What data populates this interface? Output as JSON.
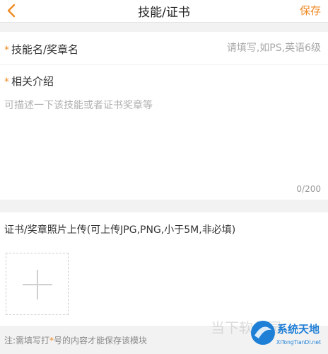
{
  "header": {
    "back_icon": "chevron-left-icon",
    "title": "技能/证书",
    "save_label": "保存"
  },
  "skill_row": {
    "required_mark": "*",
    "label": "技能名/奖章名",
    "value": "",
    "placeholder": "请填写,如PS,英语6级"
  },
  "intro": {
    "required_mark": "*",
    "label": "相关介绍",
    "value": "",
    "placeholder": "可描述一下该技能或者证书奖章等",
    "counter": "0/200"
  },
  "photo": {
    "label": "证书/奖章照片上传(可上传JPG,PNG,小于5M,非必填)",
    "add_icon": "plus-icon"
  },
  "note": {
    "prefix": "注:需填写打",
    "star": "*",
    "suffix": "号的内容才能保存该模块"
  },
  "watermark": {
    "brand": "系统天地",
    "url": "XiTongTianDi.net",
    "faded_text": "当下软件园"
  },
  "colors": {
    "accent": "#f08a24",
    "background": "#f2f2f2",
    "card": "#ffffff",
    "placeholder": "#a8a8a8"
  }
}
